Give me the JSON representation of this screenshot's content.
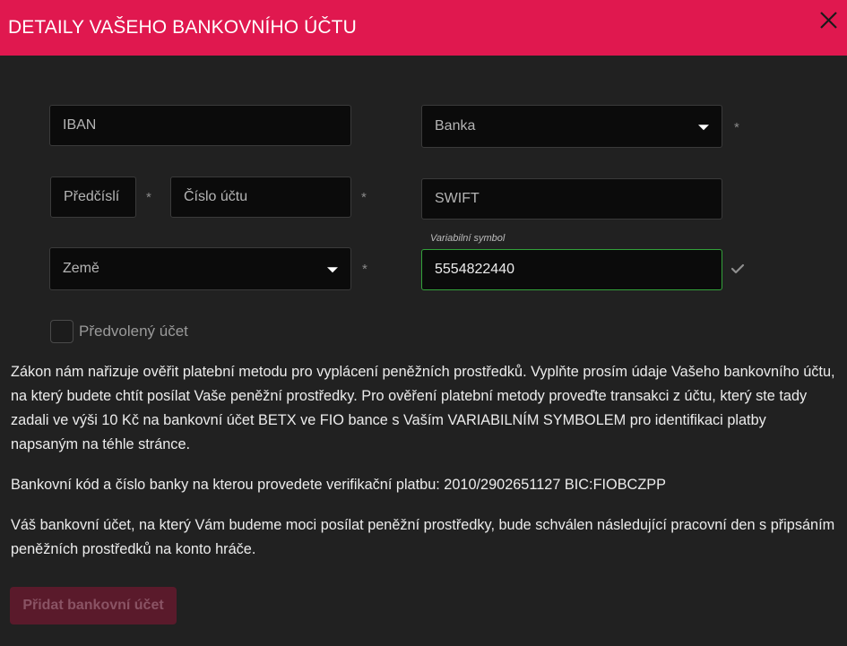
{
  "header": {
    "title": "DETAILY VAŠEHO BANKOVNÍHO ÚČTU",
    "close_icon": "close-icon"
  },
  "form": {
    "iban": {
      "placeholder": "IBAN",
      "value": ""
    },
    "bank": {
      "placeholder": "Banka",
      "selected": "",
      "required_mark": "*"
    },
    "prefix": {
      "placeholder": "Předčíslí",
      "value": "",
      "required_mark": "*"
    },
    "account_number": {
      "placeholder": "Číslo účtu",
      "value": "",
      "required_mark": "*"
    },
    "swift": {
      "placeholder": "SWIFT",
      "value": ""
    },
    "country": {
      "placeholder": "Země",
      "selected": "",
      "required_mark": "*"
    },
    "variable_symbol": {
      "label": "Variabilní symbol",
      "value": "5554822440",
      "valid_icon": "check-icon"
    },
    "default_account": {
      "label": "Předvolený účet",
      "checked": false
    }
  },
  "info": {
    "paragraph1": "Zákon nám nařizuje ověřit platební metodu pro vyplácení peněžních prostředků. Vyplňte prosím údaje Vašeho bankovního účtu, na který budete chtít posílat Vaše peněžní prostředky. Pro ověření platební metody proveďte transakci z účtu, který ste tady zadali ve výši 10 Kč na bankovní účet BETX ve FIO bance s Vaším VARIABILNÍM SYMBOLEM pro identifikaci platby napsaným na téhle stránce.",
    "paragraph2": "Bankovní kód a číslo banky na kterou provedete verifikační platbu: 2010/2902651127 BIC:FIOBCZPP",
    "paragraph3": "Váš bankovní účet, na který Vám budeme moci posílat peněžní prostředky, bude schválen následující pracovní den s připsáním peněžních prostředků na konto hráče."
  },
  "actions": {
    "submit_label": "Přidat bankovní účet"
  },
  "colors": {
    "header_bg": "#e0184f",
    "page_bg": "#212121",
    "field_bg": "#0b0b0b",
    "valid_border": "#33a13a",
    "submit_disabled_bg": "#5a1a2b"
  }
}
